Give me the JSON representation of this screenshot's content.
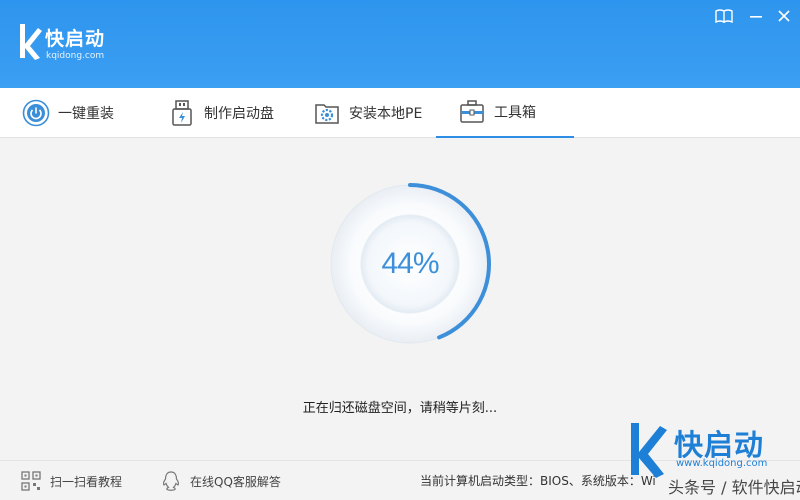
{
  "header": {
    "logo_title": "快启动",
    "logo_subtitle": "kqidong.com",
    "controls": [
      "book-icon",
      "minimize-icon",
      "close-icon"
    ]
  },
  "tabs": [
    {
      "label": "一键重装",
      "icon": "power-icon",
      "active": false
    },
    {
      "label": "制作启动盘",
      "icon": "usb-icon",
      "active": false
    },
    {
      "label": "安装本地PE",
      "icon": "gear-folder-icon",
      "active": false
    },
    {
      "label": "工具箱",
      "icon": "toolbox-icon",
      "active": true
    }
  ],
  "progress": {
    "text": "44%",
    "value": 0.44,
    "status": "正在归还磁盘空间，请稍等片刻..."
  },
  "footer": {
    "scan_label": "扫一扫看教程",
    "qq_label": "在线QQ客服解答",
    "sysinfo": "当前计算机启动类型：BIOS、系统版本：Wi"
  },
  "watermark": {
    "title": "快启动",
    "url": "www.kqidong.com",
    "caption": "头条号 / 软件快启动"
  },
  "colors": {
    "header_bg": "#3b9ff2",
    "accent": "#2e8ee6",
    "progress_text": "#3d8fd9"
  }
}
